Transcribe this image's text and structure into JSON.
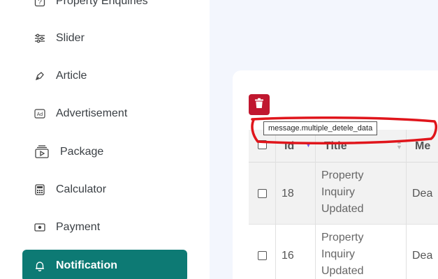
{
  "sidebar": {
    "items": [
      {
        "label": "Property Enquiries",
        "icon": "question-square-icon"
      },
      {
        "label": "Slider",
        "icon": "sliders-icon"
      },
      {
        "label": "Article",
        "icon": "pen-nib-icon"
      },
      {
        "label": "Advertisement",
        "icon": "ad-icon"
      },
      {
        "label": "Package",
        "icon": "play-package-icon"
      },
      {
        "label": "Calculator",
        "icon": "calculator-icon"
      },
      {
        "label": "Payment",
        "icon": "money-icon"
      },
      {
        "label": "Notification",
        "icon": "bell-icon",
        "active": true
      }
    ]
  },
  "toolbar": {
    "delete_tooltip": "message.multiple_detele_data",
    "delete_icon": "trash-icon"
  },
  "table": {
    "headers": {
      "id": "Id",
      "title": "Title",
      "message": "Me"
    },
    "rows": [
      {
        "id": "18",
        "title_lines": [
          "Property",
          "Inquiry",
          "Updated"
        ],
        "message": "Dea"
      },
      {
        "id": "16",
        "title_lines": [
          "Property",
          "Inquiry",
          "Updated"
        ],
        "message": "Dea"
      }
    ]
  },
  "colors": {
    "accent": "#0d7a74",
    "danger": "#c0172f",
    "annotation": "#e0151b",
    "sort_active": "#7b5ce6"
  }
}
